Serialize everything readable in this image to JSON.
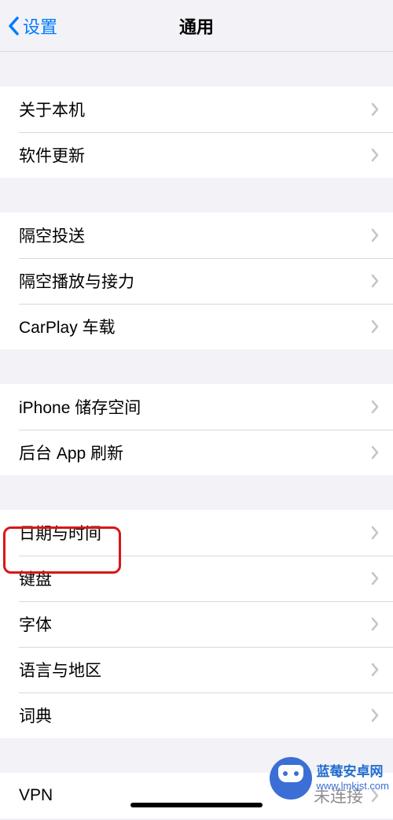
{
  "header": {
    "back_label": "设置",
    "title": "通用"
  },
  "sections": [
    {
      "items": [
        {
          "label": "关于本机"
        },
        {
          "label": "软件更新"
        }
      ]
    },
    {
      "items": [
        {
          "label": "隔空投送"
        },
        {
          "label": "隔空播放与接力"
        },
        {
          "label": "CarPlay 车载"
        }
      ]
    },
    {
      "items": [
        {
          "label": "iPhone 储存空间"
        },
        {
          "label": "后台 App 刷新"
        }
      ]
    },
    {
      "items": [
        {
          "label": "日期与时间"
        },
        {
          "label": "键盘"
        },
        {
          "label": "字体"
        },
        {
          "label": "语言与地区"
        },
        {
          "label": "词典"
        }
      ]
    },
    {
      "items": [
        {
          "label": "VPN",
          "value": "未连接"
        }
      ]
    }
  ],
  "watermark": {
    "title": "蓝莓安卓网",
    "url": "www.lmkjst.com"
  }
}
